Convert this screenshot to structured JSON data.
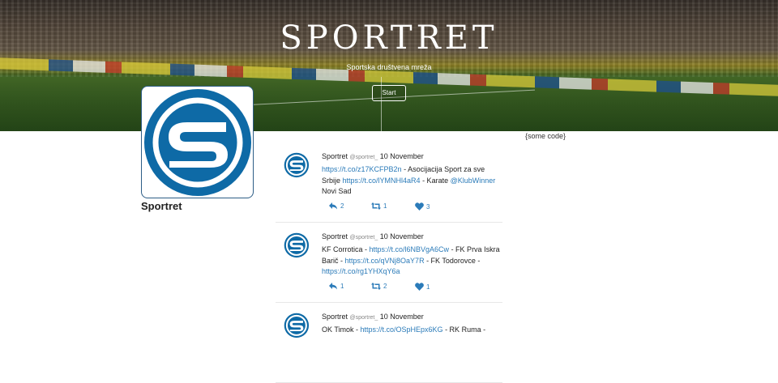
{
  "hero": {
    "title": "SPORTRET",
    "subtitle": "Sportska društvena mreža",
    "start_label": "Start"
  },
  "profile": {
    "name": "Sportret"
  },
  "sidebar": {
    "code_text": "{some code}"
  },
  "colors": {
    "brand_blue": "#0e6aa6",
    "link_blue": "#2b7bb9"
  },
  "tweets": [
    {
      "author": "Sportret",
      "handle": "@sportret_",
      "date": "10 November",
      "parts": [
        {
          "text": "https://t.co/z17KCFPB2n",
          "link": true
        },
        {
          "text": " - Asocijacija Sport za sve Srbije ",
          "link": false
        },
        {
          "text": "https://t.co/lYMNHl4aR4",
          "link": true
        },
        {
          "text": " - Karate ",
          "link": false
        },
        {
          "text": "@KlubWinner",
          "link": true
        },
        {
          "text": " Novi Sad",
          "link": false
        }
      ],
      "replies": "2",
      "retweets": "1",
      "likes": "3"
    },
    {
      "author": "Sportret",
      "handle": "@sportret_",
      "date": "10 November",
      "parts": [
        {
          "text": "KF Corrotica - ",
          "link": false
        },
        {
          "text": "https://t.co/l6NBVgA6Cw",
          "link": true
        },
        {
          "text": " - FK Prva Iskra Barič - ",
          "link": false
        },
        {
          "text": "https://t.co/qVNj8OaY7R",
          "link": true
        },
        {
          "text": " - FK Todorovce - ",
          "link": false
        },
        {
          "text": "https://t.co/rg1YHXqY6a",
          "link": true
        }
      ],
      "replies": "1",
      "retweets": "2",
      "likes": "1"
    },
    {
      "author": "Sportret",
      "handle": "@sportret_",
      "date": "10 November",
      "parts": [
        {
          "text": "OK Timok - ",
          "link": false
        },
        {
          "text": "https://t.co/OSpHEpx6KG",
          "link": true
        },
        {
          "text": " - RK Ruma -",
          "link": false
        }
      ],
      "replies": "",
      "retweets": "",
      "likes": ""
    }
  ]
}
